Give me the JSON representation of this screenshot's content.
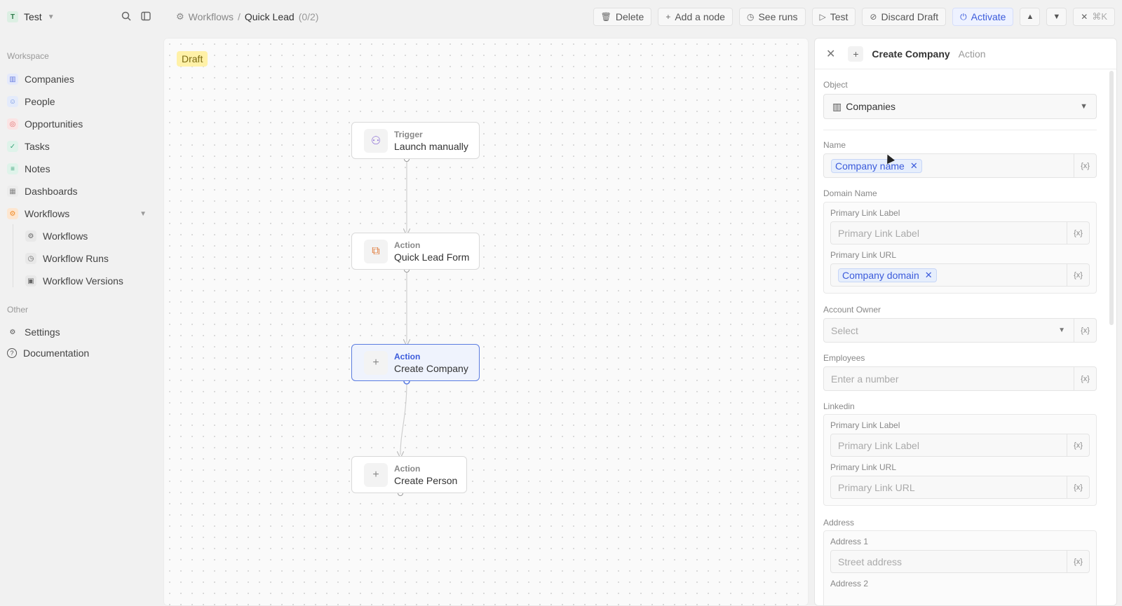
{
  "workspace": {
    "logo_letter": "T",
    "name": "Test"
  },
  "sidebar": {
    "section_workspace": "Workspace",
    "items": [
      {
        "label": "Companies",
        "icon": "building-icon",
        "color": "#6b7fe0"
      },
      {
        "label": "People",
        "icon": "person-icon",
        "color": "#6b8fe0"
      },
      {
        "label": "Opportunities",
        "icon": "target-icon",
        "color": "#e06b6b"
      },
      {
        "label": "Tasks",
        "icon": "checkbox-icon",
        "color": "#3aa37a"
      },
      {
        "label": "Notes",
        "icon": "note-icon",
        "color": "#3aa37a"
      },
      {
        "label": "Dashboards",
        "icon": "dashboard-icon",
        "color": "#888888"
      },
      {
        "label": "Workflows",
        "icon": "workflow-icon",
        "color": "#f08a24"
      }
    ],
    "sub_items": [
      {
        "label": "Workflows",
        "icon": "gear-icon"
      },
      {
        "label": "Workflow Runs",
        "icon": "history-icon"
      },
      {
        "label": "Workflow Versions",
        "icon": "versions-icon"
      }
    ],
    "section_other": "Other",
    "other_items": [
      {
        "label": "Settings",
        "icon": "gear-icon"
      },
      {
        "label": "Documentation",
        "icon": "help-icon"
      }
    ]
  },
  "breadcrumb": {
    "parent": "Workflows",
    "separator": "/",
    "current": "Quick Lead",
    "count": "(0/2)"
  },
  "toolbar": {
    "delete": "Delete",
    "add_node": "Add a node",
    "see_runs": "See runs",
    "test": "Test",
    "discard_draft": "Discard Draft",
    "activate": "Activate",
    "shortcut": "⌘K"
  },
  "canvas": {
    "badge": "Draft",
    "nodes": [
      {
        "kind": "Trigger",
        "title": "Launch manually",
        "icon": "person-plus-icon"
      },
      {
        "kind": "Action",
        "title": "Quick Lead Form",
        "icon": "form-icon"
      },
      {
        "kind": "Action",
        "title": "Create Company",
        "icon": "plus-icon"
      },
      {
        "kind": "Action",
        "title": "Create Person",
        "icon": "plus-icon"
      }
    ]
  },
  "panel": {
    "title": "Create Company",
    "subtitle": "Action",
    "object_label": "Object",
    "object_value": "Companies",
    "name_label": "Name",
    "name_chip": "Company name",
    "domain_label": "Domain Name",
    "domain_link_label_label": "Primary Link Label",
    "domain_link_label_placeholder": "Primary Link Label",
    "domain_link_url_label": "Primary Link URL",
    "domain_chip": "Company domain",
    "owner_label": "Account Owner",
    "owner_placeholder": "Select",
    "employees_label": "Employees",
    "employees_placeholder": "Enter a number",
    "linkedin_label": "Linkedin",
    "linkedin_link_label_label": "Primary Link Label",
    "linkedin_link_label_placeholder": "Primary Link Label",
    "linkedin_link_url_label": "Primary Link URL",
    "linkedin_link_url_placeholder": "Primary Link URL",
    "address_label": "Address",
    "address1_label": "Address 1",
    "address1_placeholder": "Street address",
    "address2_label": "Address 2",
    "var_symbol": "{x}"
  }
}
